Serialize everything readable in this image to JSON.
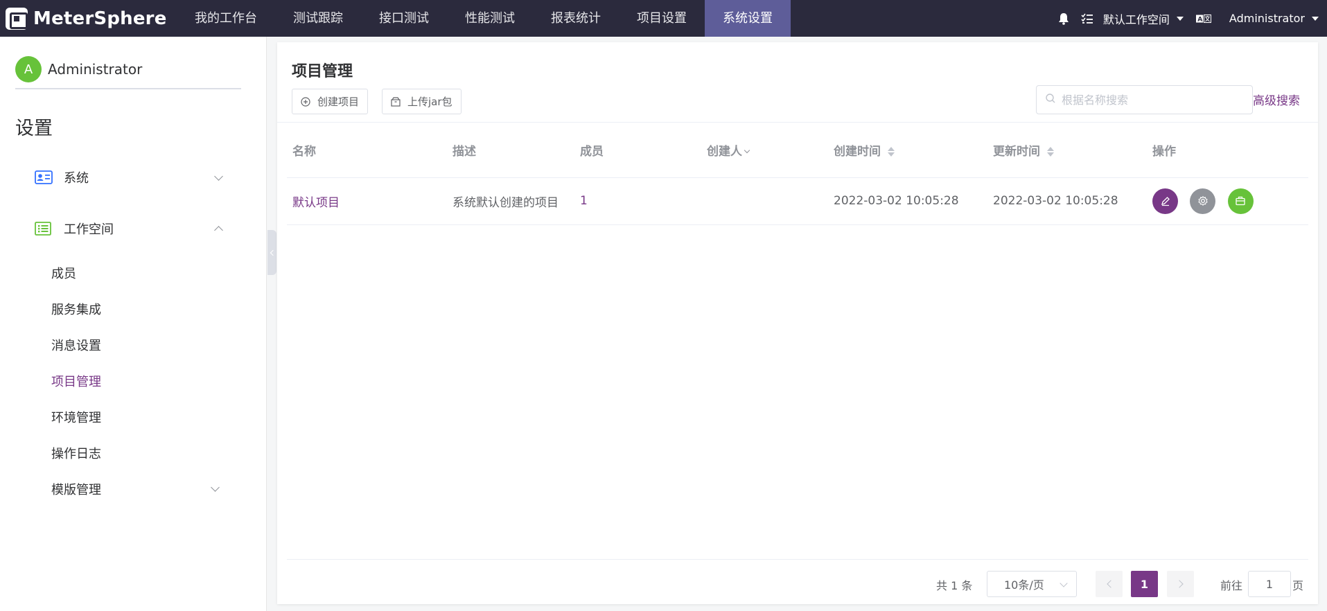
{
  "app": {
    "logo_text": "MeterSphere",
    "nav": [
      {
        "label": "我的工作台"
      },
      {
        "label": "测试跟踪"
      },
      {
        "label": "接口测试"
      },
      {
        "label": "性能测试"
      },
      {
        "label": "报表统计"
      },
      {
        "label": "项目设置"
      },
      {
        "label": "系统设置",
        "active": true
      }
    ],
    "workspace": "默认工作空间",
    "user": "Administrator",
    "icons": [
      "bell-icon",
      "task-list-icon",
      "language-icon"
    ]
  },
  "sidebar": {
    "avatar_letter": "A",
    "username": "Administrator",
    "title": "设置",
    "groups": [
      {
        "label": "系统",
        "icon": "id-card-icon",
        "expanded": false
      },
      {
        "label": "工作空间",
        "icon": "list-icon",
        "expanded": true
      }
    ],
    "items": [
      {
        "label": "成员"
      },
      {
        "label": "服务集成"
      },
      {
        "label": "消息设置"
      },
      {
        "label": "项目管理",
        "active": true
      },
      {
        "label": "环境管理"
      },
      {
        "label": "操作日志"
      },
      {
        "label": "模版管理"
      }
    ]
  },
  "main": {
    "title": "项目管理",
    "create_button": "创建项目",
    "upload_button": "上传jar包",
    "search_placeholder": "根据名称搜索",
    "advanced_search": "高级搜索",
    "columns": [
      "名称",
      "描述",
      "成员",
      "创建人",
      "创建时间",
      "更新时间",
      "操作"
    ],
    "rows": [
      {
        "name": "默认项目",
        "description": "系统默认创建的项目",
        "members": "1",
        "creator": "",
        "created": "2022-03-02 10:05:28",
        "updated": "2022-03-02 10:05:28"
      }
    ]
  },
  "pagination": {
    "total": "共 1 条",
    "page_size": "10条/页",
    "current_page": "1",
    "goto_label": "前往",
    "goto_value": "1",
    "goto_suffix": "页"
  },
  "colors": {
    "topbar": "#2b2a3d",
    "nav_active": "#5e5d99",
    "accent": "#783887",
    "env_button": "#67c23a",
    "settings_button": "#909399"
  }
}
